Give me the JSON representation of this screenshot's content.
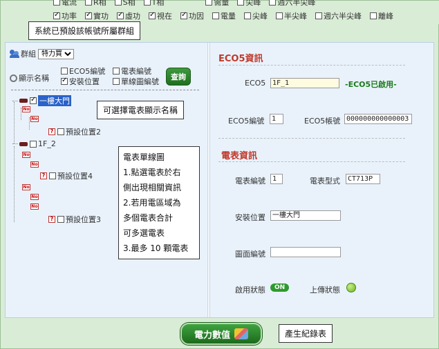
{
  "top_strip": {
    "row1": [
      "電流",
      "R相",
      "S相",
      "T相",
      "需量",
      "尖峰",
      "週六半尖峰"
    ],
    "row2": [
      {
        "label": "功率",
        "checked": true
      },
      {
        "label": "實功",
        "checked": true
      },
      {
        "label": "虛功",
        "checked": true
      },
      {
        "label": "視在",
        "checked": true
      },
      {
        "label": "功因",
        "checked": true
      },
      {
        "label": "電量",
        "checked": false
      },
      {
        "label": "尖峰",
        "checked": false
      },
      {
        "label": "半尖峰",
        "checked": false
      },
      {
        "label": "週六半尖峰",
        "checked": false
      },
      {
        "label": "離峰",
        "checked": false
      }
    ]
  },
  "left": {
    "group_label": "群組",
    "group_value": "特力買",
    "display_name_label": "顯示名稱",
    "options": [
      {
        "label": "ECO5編號",
        "checked": false
      },
      {
        "label": "電表編號",
        "checked": false
      },
      {
        "label": "安裝位置",
        "checked": true
      },
      {
        "label": "單線圖編號",
        "checked": false
      }
    ],
    "query_button": "查詢",
    "tree": {
      "node1": "一樓大門",
      "node1_child": "預設位置2",
      "node2": "1F_2",
      "node2_child_a": "預設位置4",
      "node2_child_b": "預設位置3",
      "no_badge": "No",
      "q_badge": "?"
    }
  },
  "right": {
    "eco5_title": "ECO5資訊",
    "eco5_label": "ECO5",
    "eco5_value": "1F_1",
    "eco5_status": "-ECO5已啟用-",
    "eco5_no_label": "ECO5編號",
    "eco5_no_value": "1",
    "eco5_acct_label": "ECO5帳號",
    "eco5_acct_value": "000000000000003",
    "meter_title": "電表資訊",
    "meter_no_label": "電表編號",
    "meter_no_value": "1",
    "meter_model_label": "電表型式",
    "meter_model_value": "CT713P",
    "install_label": "安裝位置",
    "install_value": "一樓大門",
    "drawing_label": "圖面編號",
    "drawing_value": "",
    "enable_label": "啟用狀態",
    "enable_value": "ON",
    "upload_label": "上傳狀態"
  },
  "callouts": {
    "group_default": "系統已預設該帳號所屬群組",
    "choose_name": "可選擇電表顯示名稱",
    "single_line": [
      "電表單線圖",
      "1.點選電表於右",
      "側出現相關資訊",
      "2.若用電區域為",
      "多個電表合計",
      "可多選電表",
      "3.最多 10 顆電表"
    ],
    "report": "產生紀錄表"
  },
  "bottom": {
    "power_button": "電力數值"
  }
}
